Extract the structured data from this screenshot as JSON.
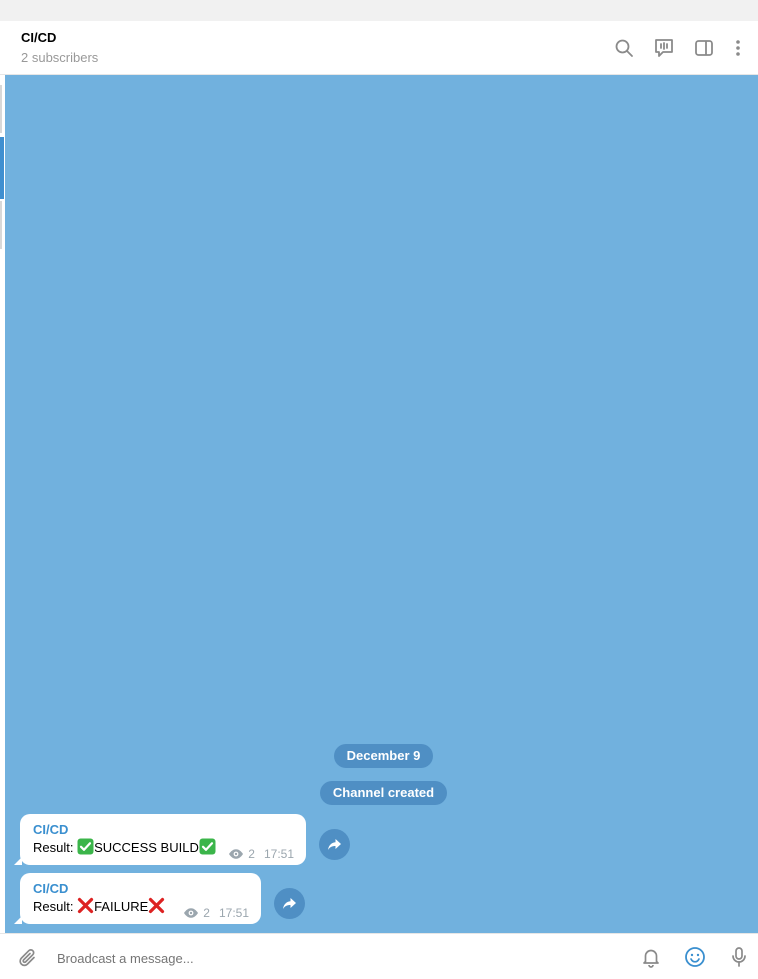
{
  "header": {
    "title": "CI/CD",
    "subtitle": "2 subscribers",
    "icons": [
      "search-icon",
      "live-stream-icon",
      "sidebar-toggle-icon",
      "more-vertical-icon"
    ]
  },
  "chat": {
    "background_color": "#71b1de",
    "date_pill": "December 9",
    "service_pill": "Channel created",
    "messages": [
      {
        "sender": "CI/CD",
        "prefix": "Result: ",
        "emoji": "check-mark-icon",
        "status": "SUCCESS BUILD",
        "views": "2",
        "time": "17:51"
      },
      {
        "sender": "CI/CD",
        "prefix": "Result: ",
        "emoji": "cross-mark-icon",
        "status": "FAILURE",
        "views": "2",
        "time": "17:51"
      }
    ]
  },
  "composer": {
    "placeholder": "Broadcast a message...",
    "icons": [
      "paperclip-icon",
      "bell-icon",
      "emoji-icon",
      "microphone-icon"
    ]
  },
  "colors": {
    "accent": "#3a8fcf",
    "pill": "#4f8fc4",
    "success": "#3bb54a",
    "failure": "#dd2222"
  }
}
